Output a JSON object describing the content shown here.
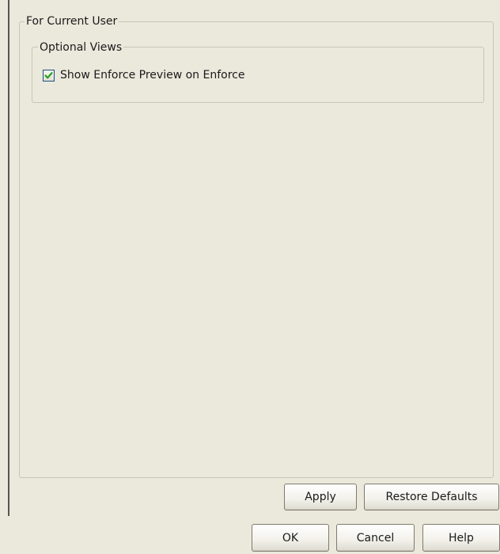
{
  "preferences": {
    "group_title": "For Current User",
    "optional_views": {
      "title": "Optional Views",
      "show_enforce_preview": {
        "label": "Show Enforce Preview on Enforce",
        "checked": true
      }
    }
  },
  "panel_buttons": {
    "apply": "Apply",
    "restore_defaults": "Restore Defaults"
  },
  "dialog_buttons": {
    "ok": "OK",
    "cancel": "Cancel",
    "help": "Help"
  }
}
